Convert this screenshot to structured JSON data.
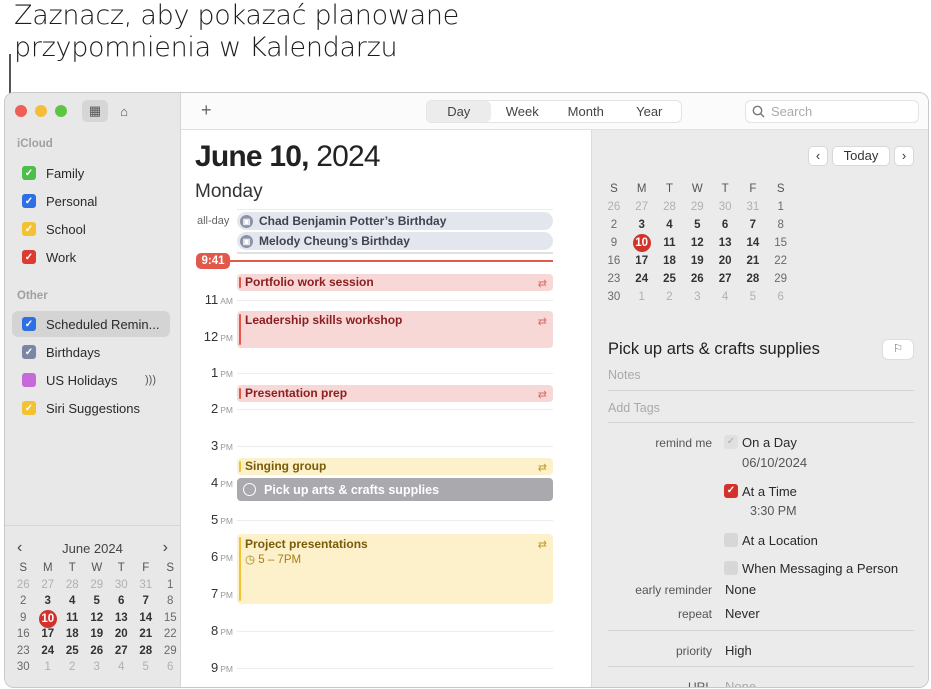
{
  "caption": {
    "line1": "Zaznacz, aby pokazać planowane",
    "line2": "przypomnienia w Kalendarzu"
  },
  "sidebar": {
    "icloud_label": "iCloud",
    "other_label": "Other",
    "icloud_calendars": [
      {
        "name": "Family",
        "color": "#4cbf4b",
        "checked": true
      },
      {
        "name": "Personal",
        "color": "#2f6fe4",
        "checked": true
      },
      {
        "name": "School",
        "color": "#f2c232",
        "checked": true
      },
      {
        "name": "Work",
        "color": "#dd3b32",
        "checked": true
      }
    ],
    "other_calendars": [
      {
        "name": "Scheduled Remin...",
        "color": "#2f6fe4",
        "checked": true,
        "selected": true
      },
      {
        "name": "Birthdays",
        "color": "#7a86a3",
        "checked": true
      },
      {
        "name": "US Holidays",
        "color": "#c56ad8",
        "checked": false,
        "broadcast_icon": "broadcast-icon"
      },
      {
        "name": "Siri Suggestions",
        "color": "#f2c232",
        "checked": true
      }
    ],
    "mini_calendar": {
      "month_label": "June 2024",
      "prev": "‹",
      "next": "›",
      "weekdays": [
        "S",
        "M",
        "T",
        "W",
        "T",
        "F",
        "S"
      ],
      "weeks": [
        [
          "26",
          "27",
          "28",
          "29",
          "30",
          "31",
          "1"
        ],
        [
          "2",
          "3",
          "4",
          "5",
          "6",
          "7",
          "8"
        ],
        [
          "9",
          "10",
          "11",
          "12",
          "13",
          "14",
          "15"
        ],
        [
          "16",
          "17",
          "18",
          "19",
          "20",
          "21",
          "22"
        ],
        [
          "23",
          "24",
          "25",
          "26",
          "27",
          "28",
          "29"
        ],
        [
          "30",
          "1",
          "2",
          "3",
          "4",
          "5",
          "6"
        ]
      ],
      "today": "10"
    }
  },
  "toolbar": {
    "add_label": "+",
    "views": [
      "Day",
      "Week",
      "Month",
      "Year"
    ],
    "active_view": "Day",
    "search_placeholder": "Search"
  },
  "day_view": {
    "date_bold": "June 10,",
    "year": "2024",
    "weekday": "Monday",
    "all_day_label": "all-day",
    "all_day_events": [
      "Chad Benjamin Potter’s Birthday",
      "Melody Cheung’s Birthday"
    ],
    "now_time": "9:41",
    "hours": [
      {
        "h": "11",
        "ap": "AM"
      },
      {
        "h": "12",
        "ap": "PM"
      },
      {
        "h": "1",
        "ap": "PM"
      },
      {
        "h": "2",
        "ap": "PM"
      },
      {
        "h": "3",
        "ap": "PM"
      },
      {
        "h": "4",
        "ap": "PM"
      },
      {
        "h": "5",
        "ap": "PM"
      },
      {
        "h": "6",
        "ap": "PM"
      },
      {
        "h": "7",
        "ap": "PM"
      },
      {
        "h": "8",
        "ap": "PM"
      },
      {
        "h": "9",
        "ap": "PM"
      }
    ],
    "events": [
      {
        "title": "Portfolio work session",
        "calendar": "Work",
        "repeat": true
      },
      {
        "title": "Leadership skills workshop",
        "calendar": "Work",
        "repeat": true
      },
      {
        "title": "Presentation prep",
        "calendar": "Work",
        "repeat": true
      },
      {
        "title": "Singing group",
        "calendar": "School",
        "repeat": true
      },
      {
        "title": "Pick up arts & crafts supplies",
        "calendar": "Scheduled Reminders",
        "type": "reminder"
      },
      {
        "title": "Project presentations",
        "calendar": "School",
        "repeat": true,
        "time": "5 – 7PM"
      }
    ]
  },
  "detail": {
    "prev": "‹",
    "today_label": "Today",
    "next": "›",
    "reminder_title": "Pick up arts & crafts supplies",
    "notes_placeholder": "Notes",
    "tags_placeholder": "Add Tags",
    "remind_me_label": "remind me",
    "on_a_day_label": "On a Day",
    "on_a_day_checked": true,
    "date_value": "06/10/2024",
    "at_a_time_label": "At a Time",
    "at_a_time_checked": true,
    "time_value": "3:30 PM",
    "at_location_label": "At a Location",
    "messaging_label": "When Messaging a Person",
    "early_reminder_label": "early reminder",
    "early_reminder_value": "None",
    "repeat_label": "repeat",
    "repeat_value": "Never",
    "priority_label": "priority",
    "priority_value": "High",
    "url_label": "URL",
    "url_value": "None"
  }
}
